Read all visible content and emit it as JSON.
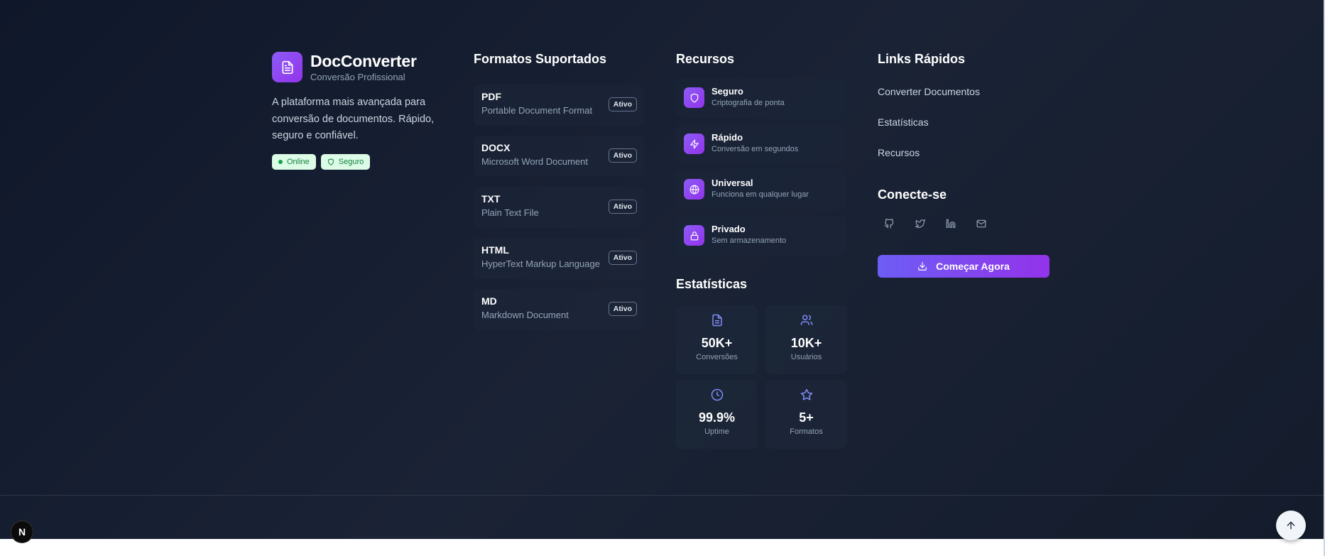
{
  "brand": {
    "name": "DocConverter",
    "subtitle": "Conversão Profissional",
    "description": "A plataforma mais avançada para conversão de documentos. Rápido, seguro e confiável.",
    "badges": [
      {
        "label": "Online",
        "icon": "dot-icon"
      },
      {
        "label": "Seguro",
        "icon": "shield-icon"
      }
    ]
  },
  "formats": {
    "title": "Formatos Suportados",
    "items": [
      {
        "name": "PDF",
        "desc": "Portable Document Format",
        "status": "Ativo"
      },
      {
        "name": "DOCX",
        "desc": "Microsoft Word Document",
        "status": "Ativo"
      },
      {
        "name": "TXT",
        "desc": "Plain Text File",
        "status": "Ativo"
      },
      {
        "name": "HTML",
        "desc": "HyperText Markup Language",
        "status": "Ativo"
      },
      {
        "name": "MD",
        "desc": "Markdown Document",
        "status": "Ativo"
      }
    ]
  },
  "resources": {
    "title": "Recursos",
    "items": [
      {
        "title": "Seguro",
        "sub": "Criptografia de ponta",
        "icon": "shield-icon"
      },
      {
        "title": "Rápido",
        "sub": "Conversão em segundos",
        "icon": "lightning-icon"
      },
      {
        "title": "Universal",
        "sub": "Funciona em qualquer lugar",
        "icon": "globe-icon"
      },
      {
        "title": "Privado",
        "sub": "Sem armazenamento",
        "icon": "lock-icon"
      }
    ]
  },
  "stats": {
    "title": "Estatísticas",
    "items": [
      {
        "value": "50K+",
        "label": "Conversões",
        "icon": "document-icon"
      },
      {
        "value": "10K+",
        "label": "Usuários",
        "icon": "users-icon"
      },
      {
        "value": "99.9%",
        "label": "Uptime",
        "icon": "clock-icon"
      },
      {
        "value": "5+",
        "label": "Formatos",
        "icon": "star-icon"
      }
    ]
  },
  "quick_links": {
    "title": "Links Rápidos",
    "items": [
      "Converter Documentos",
      "Estatísticas",
      "Recursos"
    ]
  },
  "connect": {
    "title": "Conecte-se",
    "icons": [
      "github-icon",
      "twitter-icon",
      "linkedin-icon",
      "mail-icon"
    ]
  },
  "cta": {
    "label": "Começar Agora",
    "icon": "download-icon"
  },
  "dev_badge": {
    "label": "N"
  },
  "colors": {
    "accent": "#8b5cf6",
    "accent_end": "#9333ea",
    "success": "#16a34a",
    "bg": "#0f172a"
  }
}
